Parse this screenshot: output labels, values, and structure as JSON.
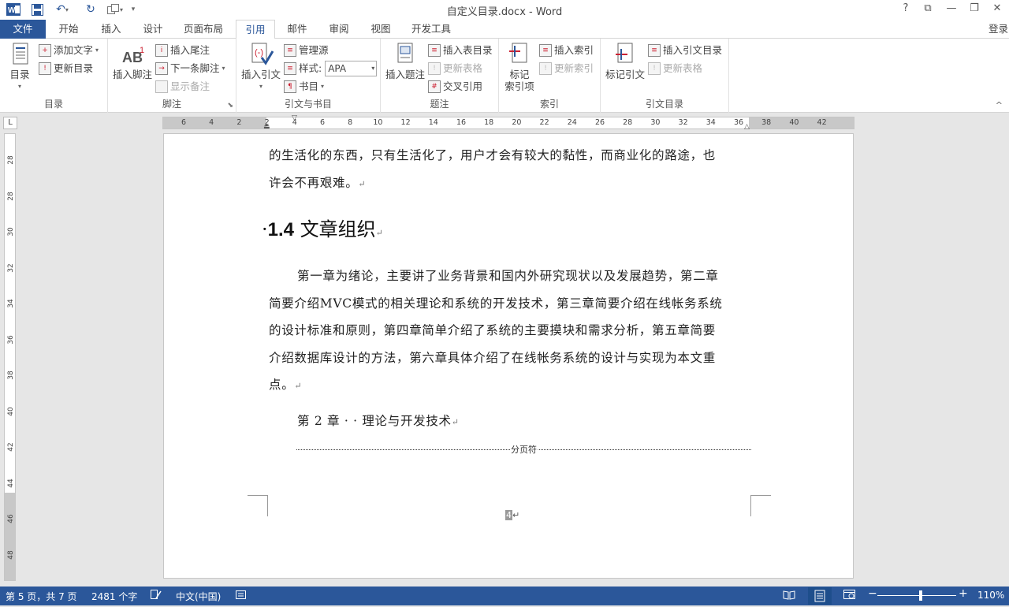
{
  "window": {
    "title": "自定义目录.docx - Word"
  },
  "qat": {
    "save_title": "保存",
    "undo": "↶",
    "redo": "↻"
  },
  "winctl": {
    "help": "?",
    "ribbon_opts": "⧉",
    "min": "—",
    "restore": "❐",
    "close": "✕"
  },
  "tabs": {
    "file": "文件",
    "home": "开始",
    "insert": "插入",
    "design": "设计",
    "layout": "页面布局",
    "references": "引用",
    "mailings": "邮件",
    "review": "审阅",
    "view": "视图",
    "developer": "开发工具",
    "login": "登录"
  },
  "ribbon": {
    "toc": {
      "btn": "目录",
      "add_text": "添加文字",
      "update": "更新目录",
      "group": "目录"
    },
    "footnotes": {
      "insert_footnote": "插入脚注",
      "insert_endnote": "插入尾注",
      "next_footnote": "下一条脚注",
      "show_notes": "显示备注",
      "group": "脚注"
    },
    "citations": {
      "insert_citation": "插入引文",
      "manage_sources": "管理源",
      "style_label": "样式:",
      "style_value": "APA",
      "bibliography": "书目",
      "group": "引文与书目"
    },
    "captions": {
      "insert_caption": "插入题注",
      "insert_tof": "插入表目录",
      "update_table": "更新表格",
      "cross_ref": "交叉引用",
      "group": "题注"
    },
    "index": {
      "mark_entry_1": "标记",
      "mark_entry_2": "索引项",
      "insert_index": "插入索引",
      "update_index": "更新索引",
      "group": "索引"
    },
    "toa": {
      "mark_citation": "标记引文",
      "insert_toa": "插入引文目录",
      "update_table": "更新表格",
      "group": "引文目录"
    }
  },
  "ruler": {
    "h": [
      "6",
      "4",
      "2",
      "2",
      "4",
      "6",
      "8",
      "10",
      "12",
      "14",
      "16",
      "18",
      "20",
      "22",
      "24",
      "26",
      "28",
      "30",
      "32",
      "34",
      "36",
      "38",
      "40",
      "42"
    ],
    "v": [
      "28",
      "28",
      "30",
      "32",
      "34",
      "36",
      "38",
      "40",
      "42",
      "44",
      "46",
      "48"
    ],
    "tab_selector": "L"
  },
  "document": {
    "para1_line1": "的生活化的东西，只有生活化了，用户才会有较大的黏性，而商业化的路途，也",
    "para1_line2": "许会不再艰难。",
    "heading_num": "1.4",
    "heading_text": " 文章组织",
    "para2_lines": [
      "第一章为绪论，主要讲了业务背景和国内外研究现状以及发展趋势，第二章",
      "简要介绍MVC模式的相关理论和系统的开发技术，第三章简要介绍在线帐务系统",
      "的设计标准和原则，第四章简单介绍了系统的主要摸块和需求分析，第五章简要",
      "介绍数据库设计的方法，第六章具体介绍了在线帐务系统的设计与实现为本文重",
      "点。"
    ],
    "chapter_line": "第 2 章 · · 理论与开发技术",
    "page_break": "分页符",
    "page_number": "4",
    "para_mark": "↵"
  },
  "status": {
    "page": "第 5 页，共 7 页",
    "words": "2481 个字",
    "language": "中文(中国)",
    "zoom": "110%",
    "zoom_level": 0.55
  },
  "colors": {
    "accent": "#2b579a"
  }
}
